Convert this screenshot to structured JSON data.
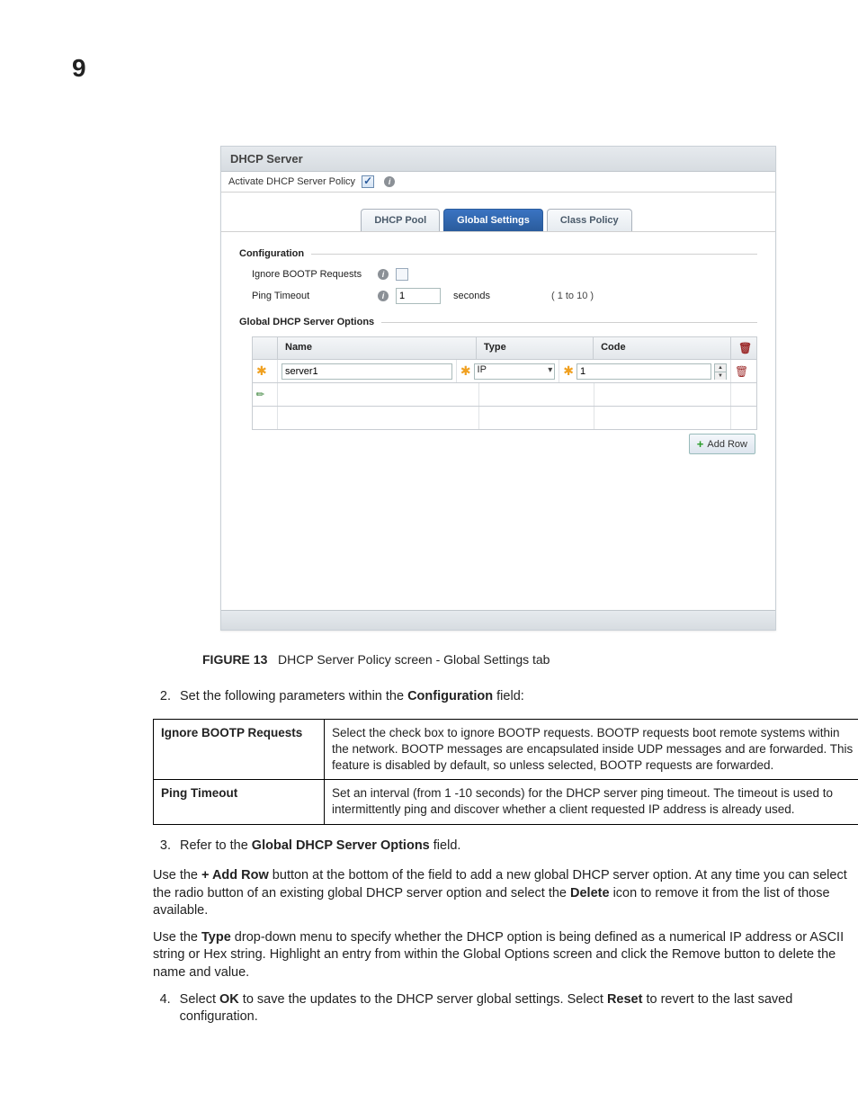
{
  "chapter": "9",
  "panel": {
    "title": "DHCP Server",
    "activate_label": "Activate DHCP Server Policy",
    "tabs": [
      "DHCP Pool",
      "Global Settings",
      "Class Policy"
    ],
    "active_tab_index": 1,
    "config": {
      "legend": "Configuration",
      "ignore_label": "Ignore BOOTP Requests",
      "ping_label": "Ping Timeout",
      "ping_value": "1",
      "ping_unit": "seconds",
      "ping_range": "( 1 to 10 )"
    },
    "options": {
      "legend": "Global DHCP Server Options",
      "cols": {
        "name": "Name",
        "type": "Type",
        "code": "Code"
      },
      "row": {
        "name": "server1",
        "type": "IP",
        "code": "1"
      },
      "add_row": "Add Row"
    }
  },
  "caption": {
    "fig": "FIGURE 13",
    "text": "DHCP Server Policy screen - Global Settings tab"
  },
  "steps": {
    "s2_prefix": "Set the following parameters within the ",
    "s2_bold": "Configuration",
    "s2_suffix": " field:",
    "s3_prefix": "Refer to the ",
    "s3_bold": "Global DHCP Server Options",
    "s3_suffix": " field.",
    "s4_p1": "Select ",
    "s4_b1": "OK",
    "s4_p2": " to save the updates to the DHCP server global settings. Select ",
    "s4_b2": "Reset",
    "s4_p3": " to revert to the last saved configuration."
  },
  "table": {
    "r1k": "Ignore BOOTP Requests",
    "r1v": "Select the check box to ignore BOOTP requests. BOOTP requests boot remote systems within the network. BOOTP messages are encapsulated inside UDP messages and are forwarded. This feature is disabled by default, so unless selected, BOOTP requests are forwarded.",
    "r2k": "Ping Timeout",
    "r2v": "Set an interval (from 1 -10 seconds) for the DHCP server ping timeout. The timeout is used to intermittently ping and discover whether a client requested IP address is already used."
  },
  "paras": {
    "p1_a": "Use the ",
    "p1_b1": "+ Add Row",
    "p1_b": " button at the bottom of the field to add a new global DHCP server option. At any time you can select the radio button of an existing global DHCP server option and select the ",
    "p1_b2": "Delete",
    "p1_c": " icon to remove it from the list of those available.",
    "p2_a": "Use the ",
    "p2_b1": "Type",
    "p2_b": " drop-down menu to specify whether the DHCP option is being defined as a numerical IP address or ASCII string or Hex string. Highlight an entry from within the Global Options screen and click the Remove button to delete the name and value."
  }
}
